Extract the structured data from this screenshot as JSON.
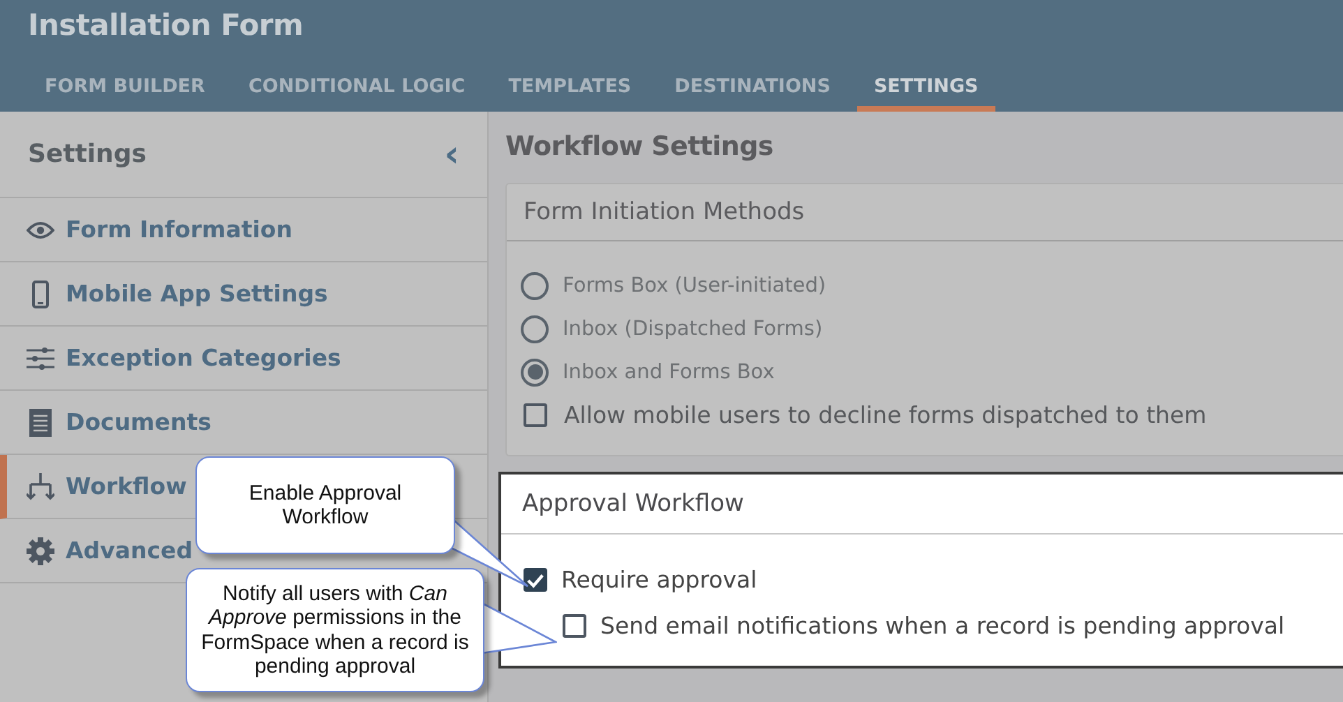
{
  "window": {
    "title": "Installation Form"
  },
  "tabs": [
    {
      "label": "FORM BUILDER",
      "selected": false
    },
    {
      "label": "CONDITIONAL LOGIC",
      "selected": false
    },
    {
      "label": "TEMPLATES",
      "selected": false
    },
    {
      "label": "DESTINATIONS",
      "selected": false
    },
    {
      "label": "SETTINGS",
      "selected": true
    }
  ],
  "sidebar": {
    "title": "Settings",
    "collapse_icon": "‹",
    "items": [
      {
        "label": "Form Information",
        "selected": false
      },
      {
        "label": "Mobile App Settings",
        "selected": false
      },
      {
        "label": "Exception Categories",
        "selected": false
      },
      {
        "label": "Documents",
        "selected": false
      },
      {
        "label": "Workflow",
        "selected": true
      },
      {
        "label": "Advanced",
        "selected": false
      }
    ]
  },
  "main": {
    "title": "Workflow Settings",
    "initiation": {
      "title": "Form Initiation Methods",
      "options": [
        {
          "kind": "radio",
          "label": "Forms Box (User-initiated)",
          "selected": false
        },
        {
          "kind": "radio",
          "label": "Inbox (Dispatched Forms)",
          "selected": false
        },
        {
          "kind": "radio",
          "label": "Inbox and Forms Box",
          "selected": true
        },
        {
          "kind": "checkbox",
          "label": "Allow mobile users to decline forms dispatched to them",
          "checked": false
        }
      ]
    },
    "approval": {
      "title": "Approval Workflow",
      "options": [
        {
          "label": "Require approval",
          "checked": true,
          "nested": false
        },
        {
          "label": "Send email notifications when a record is pending approval",
          "checked": false,
          "nested": true
        }
      ]
    }
  },
  "callouts": [
    {
      "text": "Enable Approval Workflow"
    },
    {
      "text": "Notify all users with *Can Approve* permissions in the FormSpace when a record is pending approval"
    }
  ]
}
